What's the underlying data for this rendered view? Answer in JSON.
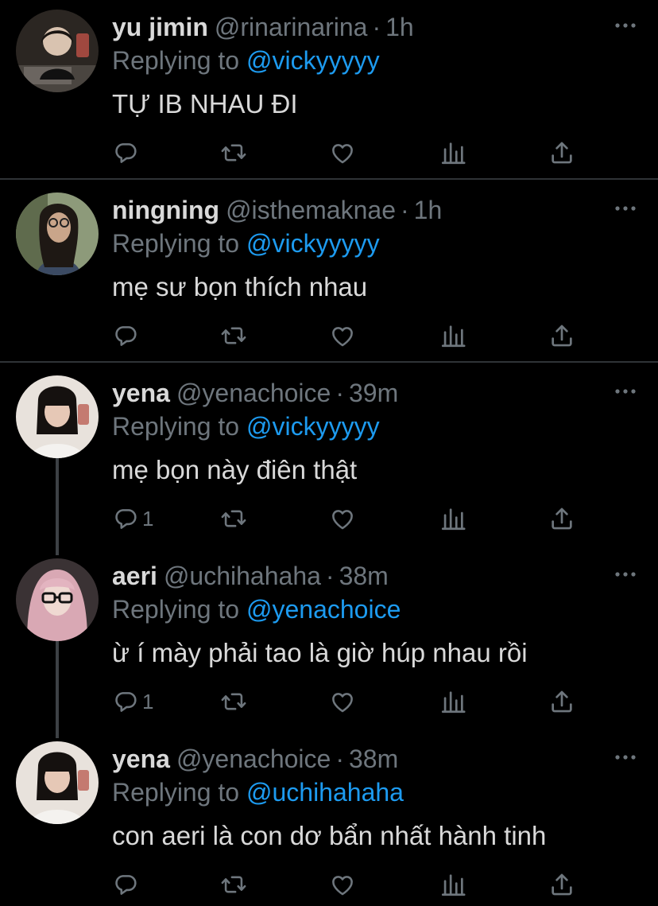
{
  "colors": {
    "background": "#000000",
    "text": "#d9d9d9",
    "muted": "#6e767d",
    "mention": "#1d9bf0",
    "divider": "#2f3336"
  },
  "tweets": [
    {
      "name": "yu jimin",
      "handle": "@rinarinarina",
      "time": "1h",
      "replying_prefix": "Replying to ",
      "replying_to": "@vickyyyyy",
      "text": "TỰ IB NHAU ĐI",
      "reply_count": ""
    },
    {
      "name": "ningning",
      "handle": "@isthemaknae",
      "time": "1h",
      "replying_prefix": "Replying to ",
      "replying_to": "@vickyyyyy",
      "text": "mẹ sư bọn thích nhau",
      "reply_count": ""
    },
    {
      "name": "yena",
      "handle": "@yenachoice",
      "time": "39m",
      "replying_prefix": "Replying to ",
      "replying_to": "@vickyyyyy",
      "text": "mẹ bọn này điên thật",
      "reply_count": "1"
    },
    {
      "name": "aeri",
      "handle": "@uchihahaha",
      "time": "38m",
      "replying_prefix": "Replying to ",
      "replying_to": "@yenachoice",
      "text": "ừ í mày phải tao là giờ húp nhau rồi",
      "reply_count": "1"
    },
    {
      "name": "yena",
      "handle": "@yenachoice",
      "time": "38m",
      "replying_prefix": "Replying to ",
      "replying_to": "@uchihahaha",
      "text": "con aeri là con dơ bẩn nhất hành tinh",
      "reply_count": ""
    }
  ],
  "separator": "·",
  "icons": [
    "reply-icon",
    "retweet-icon",
    "like-icon",
    "analytics-icon",
    "share-icon",
    "more-icon"
  ]
}
